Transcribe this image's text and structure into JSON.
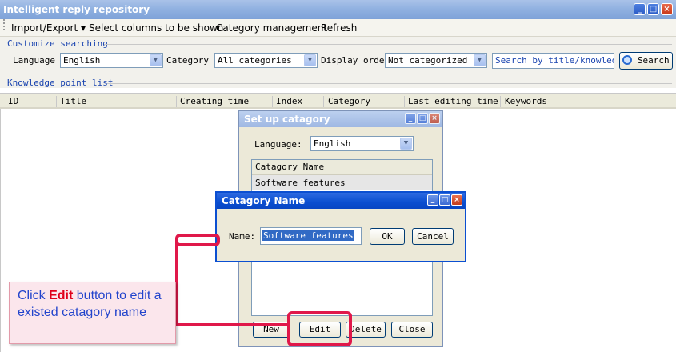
{
  "window": {
    "title": "Intelligent reply repository",
    "controls": [
      "_",
      "□",
      "×"
    ]
  },
  "menu": {
    "import_export": "Import/Export ▾",
    "select_columns": "Select columns to be shown",
    "category_management": "Category management",
    "refresh": "Refresh"
  },
  "search": {
    "section_title": "Customize searching",
    "language_label": "Language",
    "language_value": "English",
    "category_label": "Category",
    "category_value": "All categories",
    "display_order_label": "Display order",
    "display_order_value": "Not categorized",
    "search_text": "Search by title/knowledge",
    "search_button": "Search"
  },
  "list": {
    "section_title": "Knowledge point list",
    "columns": [
      "ID",
      "Title",
      "Creating time",
      "Index",
      "Category",
      "Last editing time",
      "Keywords"
    ]
  },
  "setup_dialog": {
    "title": "Set up catagory",
    "language_label": "Language:",
    "language_value": "English",
    "list_header": "Catagory Name",
    "items": [
      "Software features"
    ],
    "buttons": {
      "new": "New",
      "edit": "Edit",
      "delete": "Delete",
      "close": "Close"
    }
  },
  "name_dialog": {
    "title": "Catagory Name",
    "name_label": "Name:",
    "name_value": "Software features",
    "ok": "OK",
    "cancel": "Cancel"
  },
  "callout": {
    "text_before": "Click ",
    "highlight": "Edit",
    "text_after": " button to edit a existed catagory name"
  },
  "colors": {
    "accent_red": "#e0184a",
    "title_blue": "#0a4ed0",
    "label_blue": "#1a44b0"
  }
}
